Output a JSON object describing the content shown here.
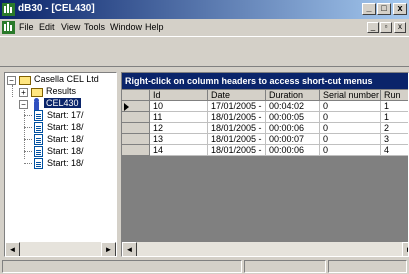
{
  "window": {
    "title": "dB30 - [CEL430]"
  },
  "titlebar_buttons": [
    "_",
    "□",
    "x"
  ],
  "menu": [
    "File",
    "Edit",
    "View",
    "Tools",
    "Window",
    "Help"
  ],
  "mdi_buttons": [
    "_",
    "▫",
    "x"
  ],
  "tree": {
    "root": "Casella CEL Ltd",
    "results": "Results",
    "device": "CEL430",
    "items": [
      "Start: 17/",
      "Start: 18/",
      "Start: 18/",
      "Start: 18/",
      "Start: 18/"
    ],
    "expand_symbol": "+",
    "collapse_symbol": "−"
  },
  "grid": {
    "caption": "Right-click on column headers to access short-cut menus",
    "columns": [
      "Id",
      "Date",
      "Duration",
      "Serial number",
      "Run"
    ],
    "rows": [
      [
        "10",
        "17/01/2005 -",
        "00:04:02",
        "0",
        "1"
      ],
      [
        "11",
        "18/01/2005 -",
        "00:00:05",
        "0",
        "1"
      ],
      [
        "12",
        "18/01/2005 -",
        "00:00:06",
        "0",
        "2"
      ],
      [
        "13",
        "18/01/2005 -",
        "00:00:07",
        "0",
        "3"
      ],
      [
        "14",
        "18/01/2005 -",
        "00:00:06",
        "0",
        "4"
      ]
    ],
    "current_row_index": 0
  },
  "scroll_arrows": {
    "left": "◄",
    "right": "►"
  }
}
